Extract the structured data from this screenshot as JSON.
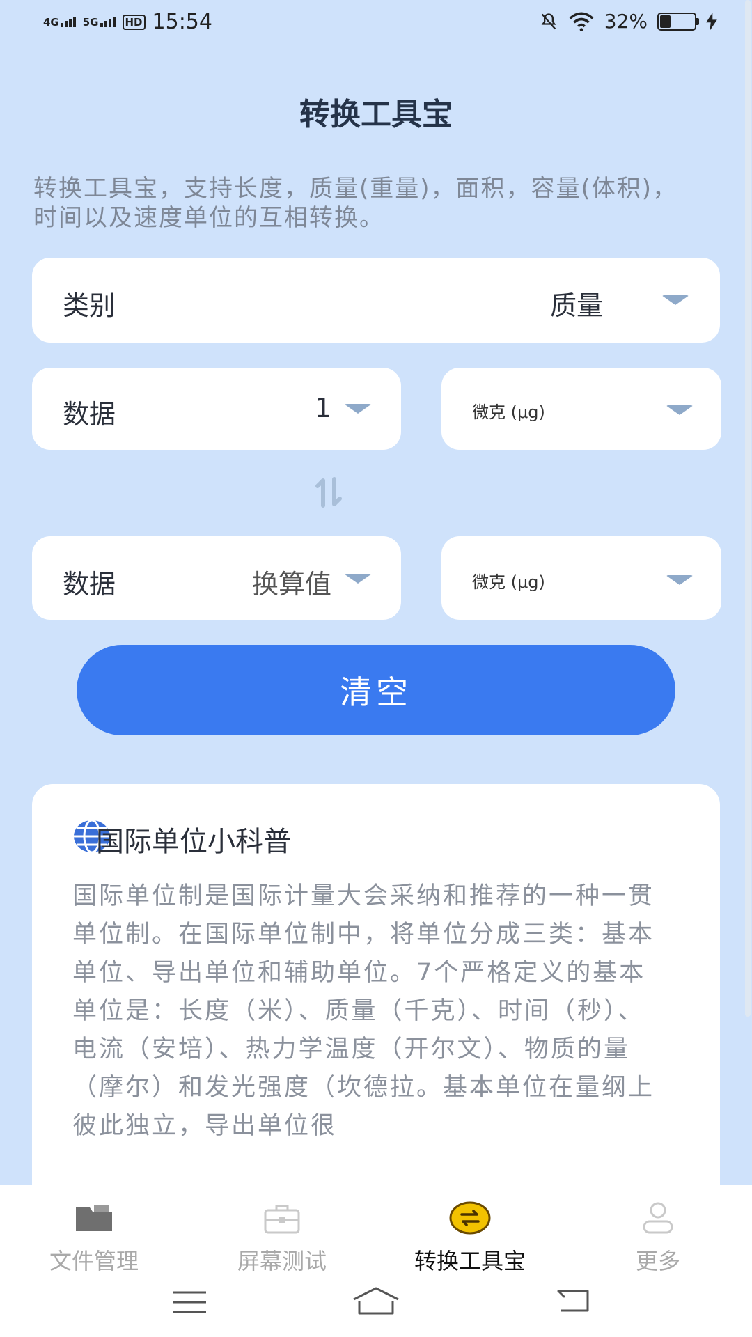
{
  "status_bar": {
    "net1": "4G",
    "net2": "5G",
    "hd": "HD",
    "time": "15:54",
    "battery": "32%",
    "battery_level": 0.32
  },
  "header": {
    "title": "转换工具宝"
  },
  "description": "转换工具宝，支持长度，质量(重量)，面积，容量(体积)，时间以及速度单位的互相转换。",
  "category": {
    "label": "类别",
    "value": "质量"
  },
  "input_row": {
    "label": "数据",
    "value": "1",
    "unit": "微克 (μg)"
  },
  "output_row": {
    "label": "数据",
    "value": "换算值",
    "unit": "微克 (μg)"
  },
  "clear_button": "清空",
  "info": {
    "title": "国际单位小科普",
    "body": "国际单位制是国际计量大会采纳和推荐的一种一贯单位制。在国际单位制中，将单位分成三类：基本单位、导出单位和辅助单位。7个严格定义的基本单位是：长度（米）、质量（千克）、时间（秒）、电流（安培）、热力学温度（开尔文）、物质的量（摩尔）和发光强度（坎德拉。基本单位在量纲上彼此独立，导出单位很"
  },
  "tabs": [
    {
      "label": "文件管理",
      "icon": "folder-icon"
    },
    {
      "label": "屏幕测试",
      "icon": "briefcase-icon"
    },
    {
      "label": "转换工具宝",
      "icon": "swap-icon"
    },
    {
      "label": "更多",
      "icon": "person-icon"
    }
  ],
  "colors": {
    "background": "#cfe2fb",
    "accent": "#3a7af0",
    "active_tab_icon": "#f2c200"
  }
}
